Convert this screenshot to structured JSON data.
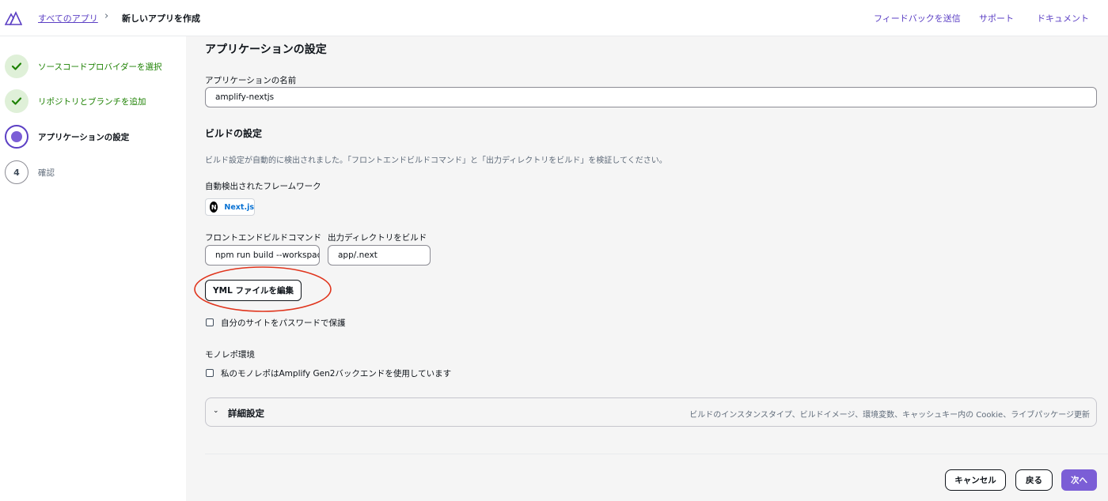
{
  "breadcrumb": {
    "all_apps": "すべてのアプリ",
    "separator": "›",
    "current": "新しいアプリを作成"
  },
  "top_links": [
    "フィードバックを送信",
    "サポート",
    "ドキュメント"
  ],
  "steps": [
    {
      "number": "",
      "label": "ソースコードプロバイダーを選択",
      "state": "done"
    },
    {
      "number": "",
      "label": "リポジトリとブランチを追加",
      "state": "done"
    },
    {
      "number": "",
      "label": "アプリケーションの設定",
      "state": "active"
    },
    {
      "number": "4",
      "label": "確認",
      "state": "pending"
    }
  ],
  "main": {
    "title": "アプリケーションの設定",
    "app_name_label": "アプリケーションの名前",
    "app_name_value": "amplify-nextjs",
    "build_heading": "ビルドの設定",
    "build_desc": "ビルド設定が自動的に検出されました。「フロントエンドビルドコマンド」と「出力ディレクトリをビルド」を検証してください。",
    "framework_label": "自動検出されたフレームワーク",
    "framework_logo": "N",
    "framework_name": "Next.js",
    "build_cmd_label": "フロントエンドビルドコマンド",
    "build_cmd_value": "npm run build --workspace",
    "output_dir_label": "出力ディレクトリをビルド",
    "output_dir_value": "app/.next",
    "edit_yml_button": "YML ファイルを編集",
    "password_protect_label": "自分のサイトをパスワードで保護",
    "monorepo_heading": "モノレポ環境",
    "monorepo_checkbox_label": "私のモノレポはAmplify Gen2バックエンドを使用しています",
    "advanced_title": "詳細設定",
    "advanced_desc": "ビルドのインスタンスタイプ、ビルドイメージ、環境変数、キャッシュキー内の Cookie、ライブパッケージ更新"
  },
  "footer": {
    "cancel": "キャンセル",
    "back": "戻る",
    "next": "次へ"
  },
  "colors": {
    "accent": "#7b5ed6",
    "link": "#5b3fc4",
    "success": "#1d8102",
    "highlight": "#e0341c"
  },
  "icons": [
    "amplify-logo-icon",
    "check-icon",
    "chevron-down-icon",
    "nextjs-logo-icon"
  ]
}
